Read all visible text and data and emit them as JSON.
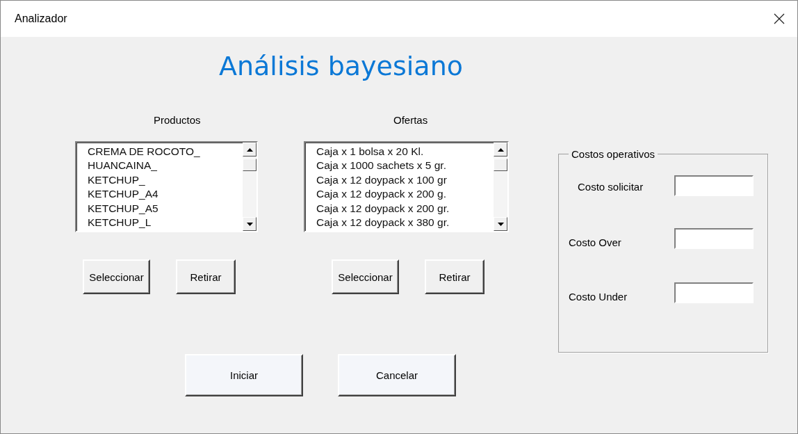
{
  "window": {
    "title": "Analizador"
  },
  "heading": "Análisis bayesiano",
  "lists": [
    {
      "label": "Productos",
      "items": [
        "CREMA DE ROCOTO_",
        "HUANCAINA_",
        "KETCHUP_",
        "KETCHUP_A4",
        "KETCHUP_A5",
        "KETCHUP_L"
      ],
      "buttons": [
        "Seleccionar",
        "Retirar"
      ]
    },
    {
      "label": "Ofertas",
      "items": [
        "Caja x 1 bolsa x 20 Kl.",
        "Caja x 1000 sachets x 5 gr.",
        "Caja x 12 doypack x 100 gr",
        "Caja x 12 doypack x 200 g.",
        "Caja x 12 doypack x 200 gr.",
        "Caja x 12 doypack x 380 gr."
      ],
      "buttons": [
        "Seleccionar",
        "Retirar"
      ]
    }
  ],
  "costs": {
    "title": "Costos operativos",
    "fields": [
      {
        "label": "Costo solicitar"
      },
      {
        "label": "Costo Over"
      },
      {
        "label": "Costo Under"
      }
    ]
  },
  "actions": [
    "Iniciar",
    "Cancelar"
  ]
}
